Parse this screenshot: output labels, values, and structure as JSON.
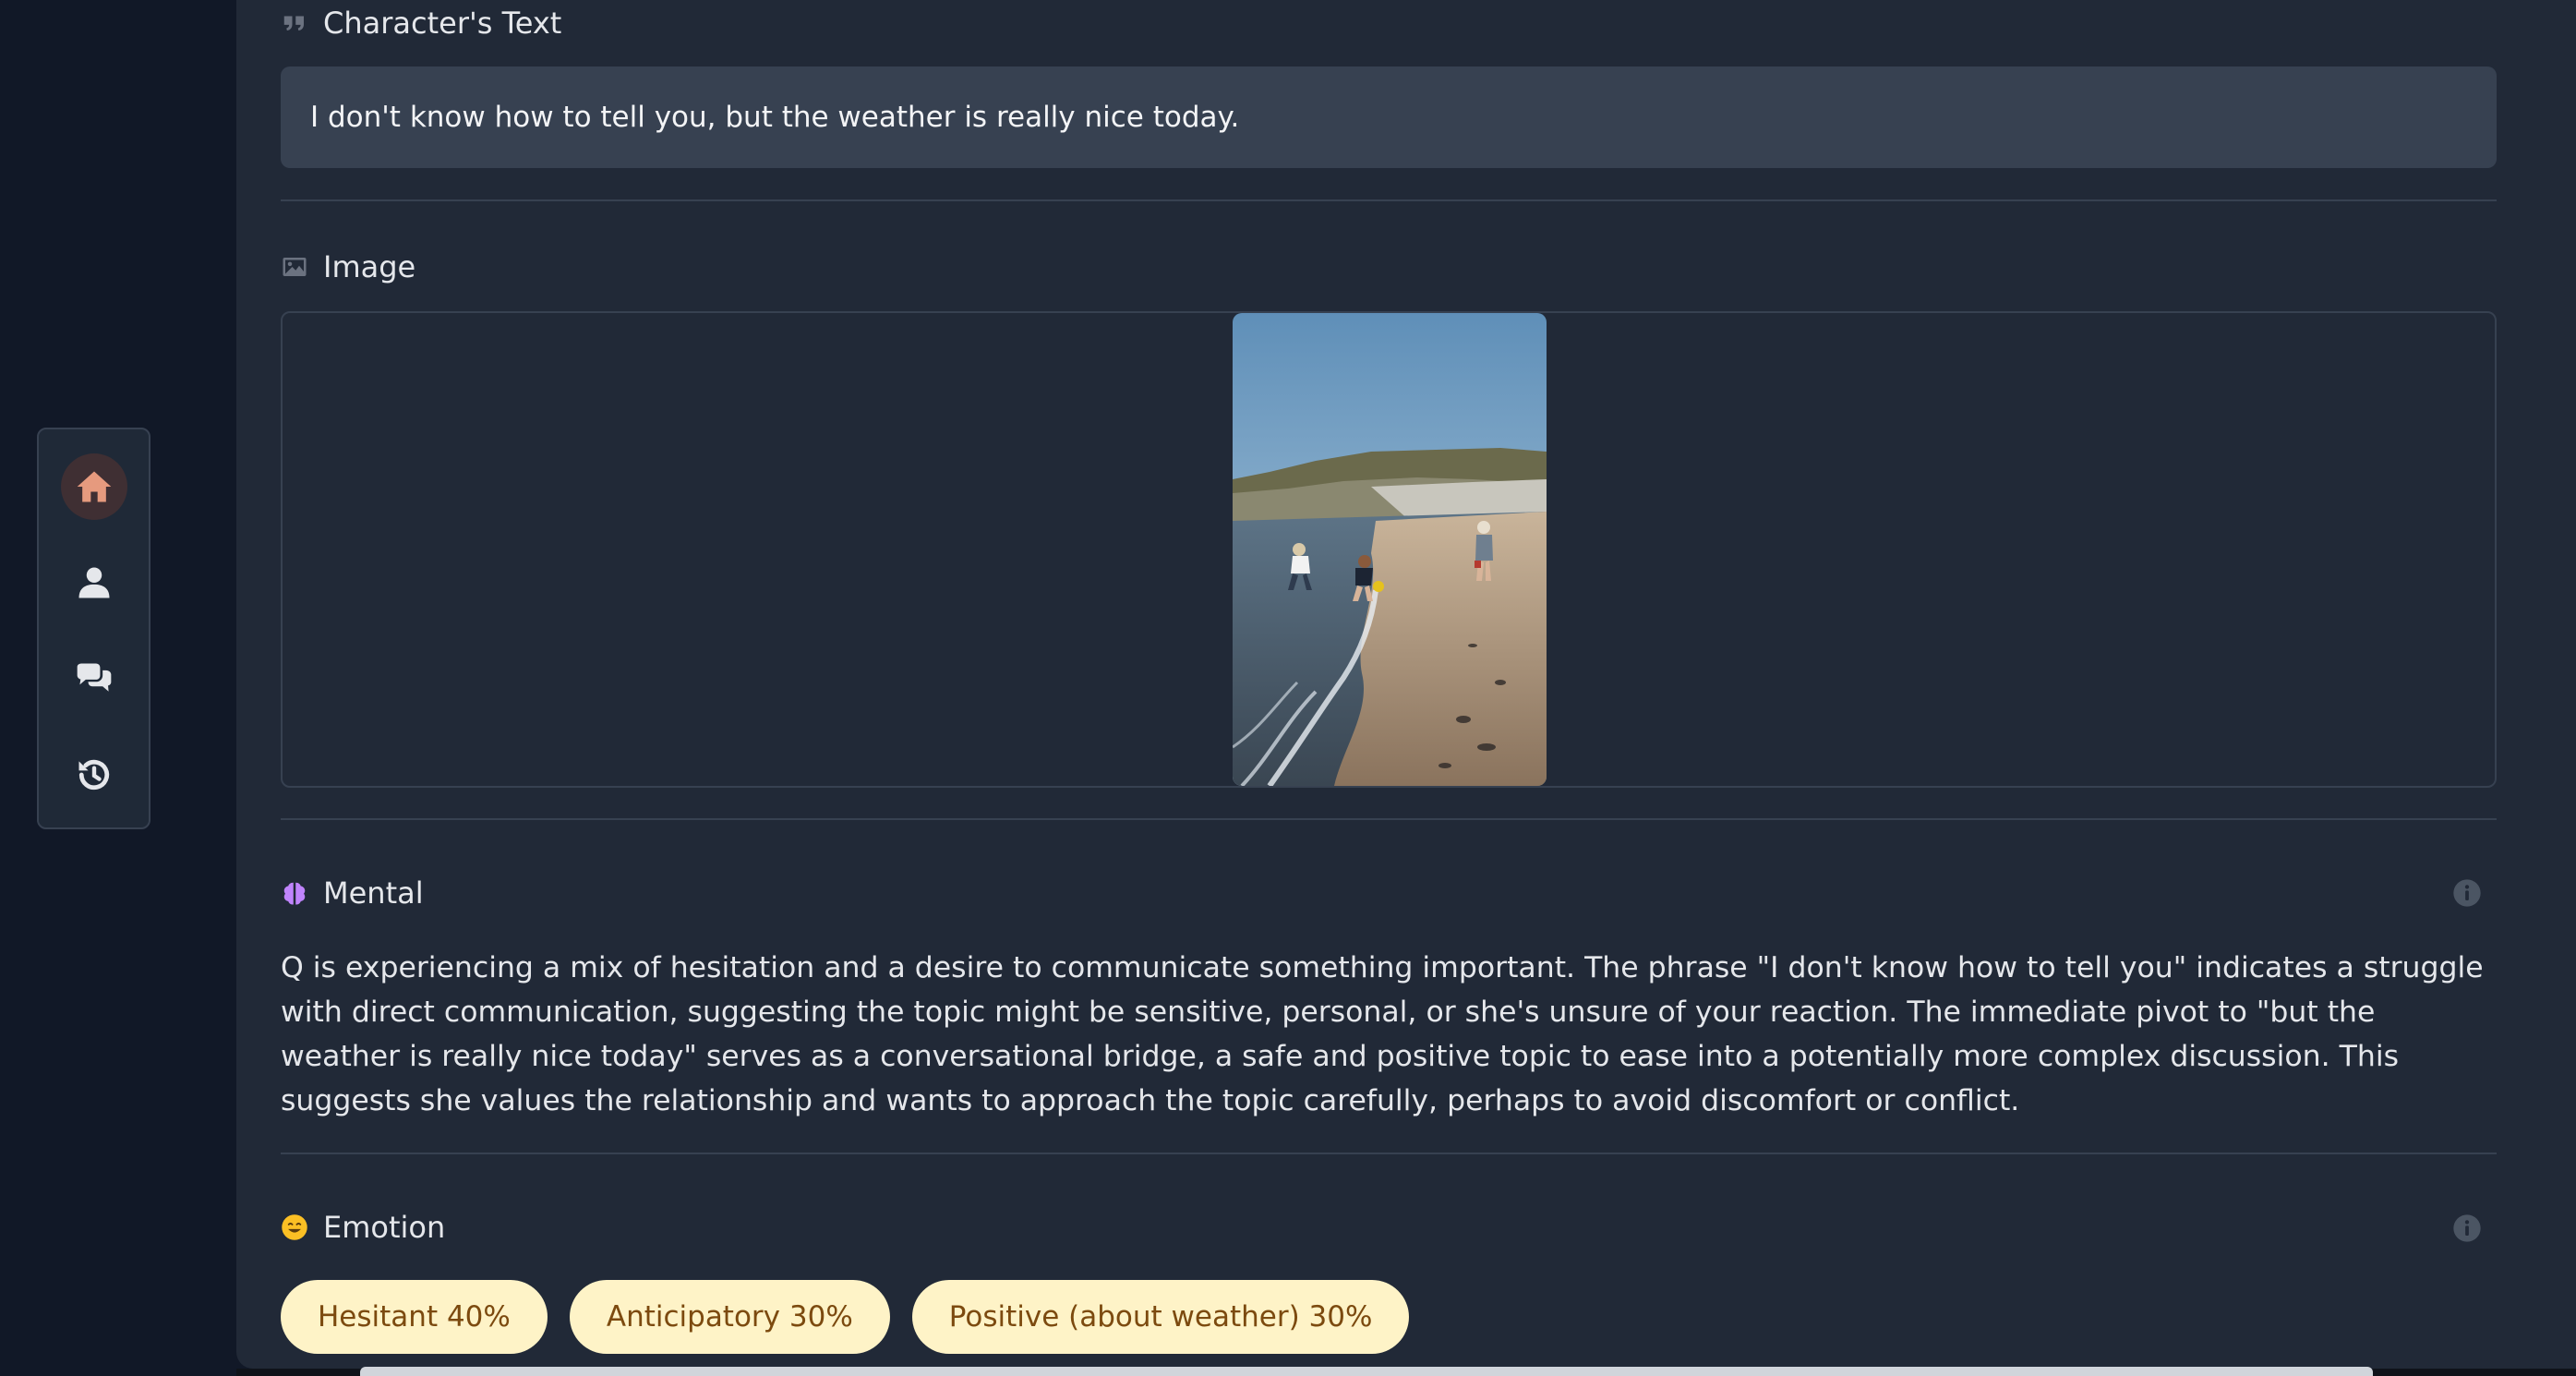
{
  "nav": {
    "items": [
      {
        "icon": "home-icon",
        "active": true
      },
      {
        "icon": "user-icon",
        "active": false
      },
      {
        "icon": "chat-icon",
        "active": false
      },
      {
        "icon": "history-icon",
        "active": false
      }
    ],
    "active_color": "#e69a7e"
  },
  "character_text": {
    "heading": "Character's Text",
    "icon": "quote-icon",
    "text": "I don't know how to tell you, but the weather is really nice today."
  },
  "image_section": {
    "heading": "Image",
    "icon": "image-icon"
  },
  "mental": {
    "heading": "Mental",
    "icon": "brain-icon",
    "icon_color": "#c084fc",
    "text": "Q is experiencing a mix of hesitation and a desire to communicate something important. The phrase \"I don't know how to tell you\" indicates a struggle with direct communication, suggesting the topic might be sensitive, personal, or she's unsure of your reaction. The immediate pivot to \"but the weather is really nice today\" serves as a conversational bridge, a safe and positive topic to ease into a potentially more complex discussion. This suggests she values the relationship and wants to approach the topic carefully, perhaps to avoid discomfort or conflict."
  },
  "emotion": {
    "heading": "Emotion",
    "icon": "smile-icon",
    "icon_color": "#fbbf24",
    "tags": [
      "Hesitant 40%",
      "Anticipatory 30%",
      "Positive (about weather) 30%"
    ],
    "tag_bg": "#fef3c7",
    "tag_text": "#7c4a0f"
  }
}
